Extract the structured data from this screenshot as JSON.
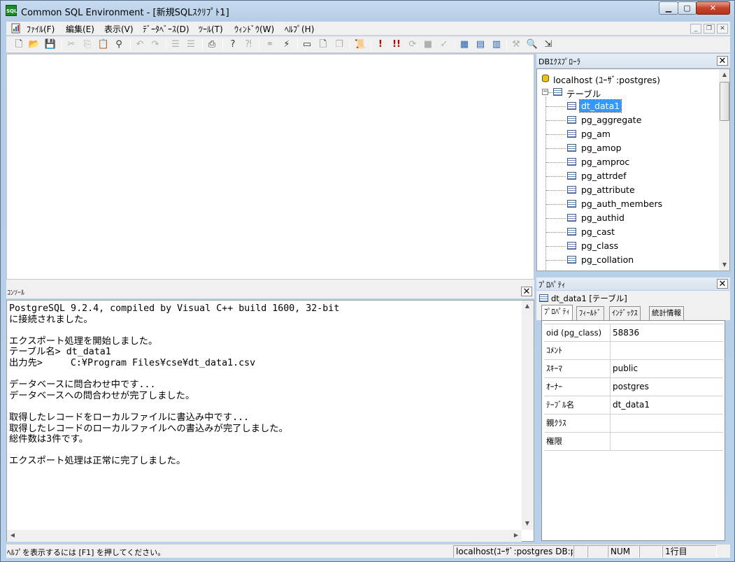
{
  "window": {
    "title": "Common SQL Environment - [新規SQLｽｸﾘﾌﾟﾄ1]",
    "app_icon_text": "SQL"
  },
  "menu": [
    {
      "label": "ﾌｧｲﾙ(F)"
    },
    {
      "label": "編集(E)"
    },
    {
      "label": "表示(V)"
    },
    {
      "label": "ﾃﾞｰﾀﾍﾞｰｽ(D)"
    },
    {
      "label": "ﾂｰﾙ(T)"
    },
    {
      "label": "ｳｨﾝﾄﾞｳ(W)"
    },
    {
      "label": "ﾍﾙﾌﾟ(H)"
    }
  ],
  "toolbar": {
    "icons": [
      "new-icon",
      "open-icon",
      "save-icon",
      "cut-icon",
      "copy-icon",
      "paste-icon",
      "find-icon",
      "undo-icon",
      "redo-icon",
      "indent-icon",
      "outdent-icon",
      "print-icon",
      "help-icon",
      "context-help-icon",
      "connect-icon",
      "disconnect-icon",
      "window-icon",
      "document-icon",
      "cascade-icon",
      "script-icon",
      "execute-icon",
      "execute-all-icon",
      "step-icon",
      "stop-icon",
      "explain-icon",
      "table-new-icon",
      "table-edit-icon",
      "table-view-icon",
      "tools-icon",
      "search-icon",
      "export-icon"
    ]
  },
  "console": {
    "title": "ｺﾝｿｰﾙ",
    "lines": [
      "PostgreSQL 9.2.4, compiled by Visual C++ build 1600, 32-bit",
      "に接続されました。",
      "",
      "エクスポート処理を開始しました。",
      "テーブル名> dt_data1",
      "出力先>     C:¥Program Files¥cse¥dt_data1.csv",
      "",
      "データベースに問合わせ中です...",
      "データベースへの問合わせが完了しました。",
      "",
      "取得したレコードをローカルファイルに書込み中です...",
      "取得したレコードのローカルファイルへの書込みが完了しました。",
      "総件数は3件です。",
      "",
      "エクスポート処理は正常に完了しました。"
    ]
  },
  "db_explorer": {
    "title": "DBｴｸｽﾌﾟﾛｰﾗ",
    "root": "localhost (ﾕｰｻﾞ:postgres)",
    "folder": "テーブル",
    "selected": "dt_data1",
    "tables": [
      "dt_data1",
      "pg_aggregate",
      "pg_am",
      "pg_amop",
      "pg_amproc",
      "pg_attrdef",
      "pg_attribute",
      "pg_auth_members",
      "pg_authid",
      "pg_cast",
      "pg_class",
      "pg_collation"
    ]
  },
  "properties": {
    "title": "ﾌﾟﾛﾊﾟﾃｨ",
    "subject": "dt_data1 [テーブル]",
    "tabs": [
      {
        "label": "ﾌﾟﾛﾊﾟﾃｨ",
        "active": true
      },
      {
        "label": "ﾌｨｰﾙﾄﾞ",
        "active": false
      },
      {
        "label": "ｲﾝﾃﾞｯｸｽ",
        "active": false
      },
      {
        "label": "統計情報",
        "active": false
      }
    ],
    "rows": [
      {
        "key": "oid (pg_class)",
        "value": "58836"
      },
      {
        "key": "ｺﾒﾝﾄ",
        "value": ""
      },
      {
        "key": "ｽｷｰﾏ",
        "value": "public"
      },
      {
        "key": "ｵｰﾅｰ",
        "value": "postgres"
      },
      {
        "key": "ﾃｰﾌﾞﾙ名",
        "value": "dt_data1"
      },
      {
        "key": "親ｸﾗｽ",
        "value": ""
      },
      {
        "key": "権限",
        "value": ""
      }
    ]
  },
  "statusbar": {
    "help": "ﾍﾙﾌﾟを表示するには [F1] を押してください。",
    "connection": "localhost(ﾕｰｻﾞ:postgres DB:p",
    "num": "NUM",
    "line": "1行目"
  },
  "colors": {
    "selection": "#3399ff",
    "title_gradient": "#b9d1ea",
    "close_button": "#c4452b"
  }
}
